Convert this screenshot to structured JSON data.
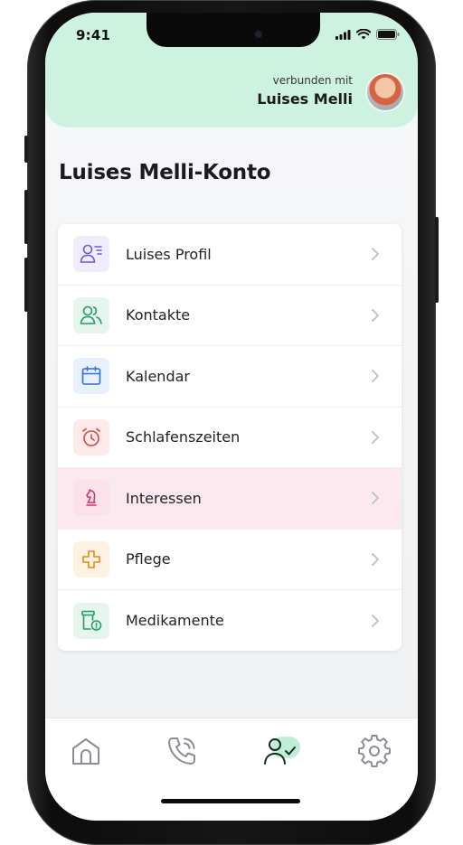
{
  "status_bar": {
    "time": "9:41"
  },
  "header": {
    "connected_label": "verbunden mit",
    "connected_name": "Luises Melli"
  },
  "page": {
    "title": "Luises Melli-Konto"
  },
  "menu": {
    "items": [
      {
        "label": "Luises Profil",
        "icon": "profile-icon"
      },
      {
        "label": "Kontakte",
        "icon": "contacts-icon"
      },
      {
        "label": "Kalendar",
        "icon": "calendar-icon"
      },
      {
        "label": "Schlafenszeiten",
        "icon": "alarm-clock-icon"
      },
      {
        "label": "Interessen",
        "icon": "chess-knight-icon"
      },
      {
        "label": "Pflege",
        "icon": "medical-cross-icon"
      },
      {
        "label": "Medikamente",
        "icon": "medication-icon"
      }
    ]
  },
  "tabbar": {
    "tabs": [
      {
        "name": "home",
        "icon": "home-icon"
      },
      {
        "name": "calls",
        "icon": "phone-icon"
      },
      {
        "name": "account",
        "icon": "user-check-icon",
        "active": true
      },
      {
        "name": "settings",
        "icon": "gear-icon"
      }
    ]
  },
  "colors": {
    "header_bg": "#cdf3e0",
    "accent": "#1f9c6f",
    "highlight_row": "#fbe9ef"
  }
}
